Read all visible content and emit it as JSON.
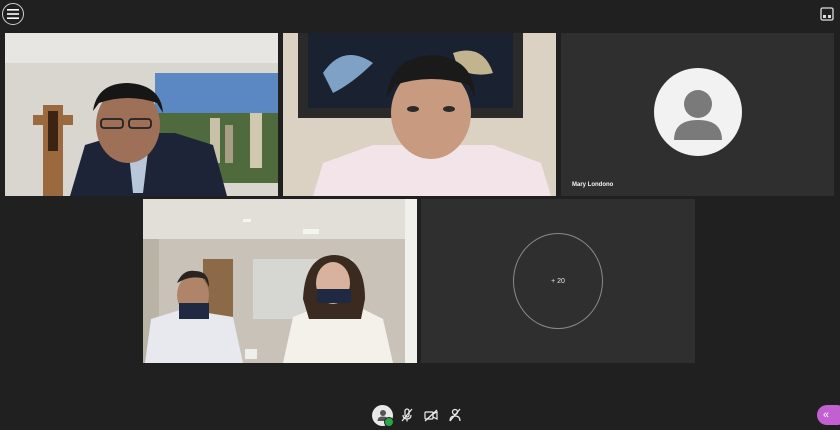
{
  "participants": [
    {
      "id": "p1"
    },
    {
      "id": "p2"
    },
    {
      "id": "p3",
      "name": "Mary Londono"
    },
    {
      "id": "p4"
    }
  ],
  "more_participants": {
    "label": "+ 20"
  },
  "toolbar": {
    "icons": [
      "user-icon",
      "mic-off-icon",
      "camera-off-icon",
      "share-screen-icon"
    ]
  },
  "colors": {
    "background": "#202020",
    "tile": "#2f2f2f",
    "accent": "#c25fd1",
    "ok": "#28a745"
  }
}
